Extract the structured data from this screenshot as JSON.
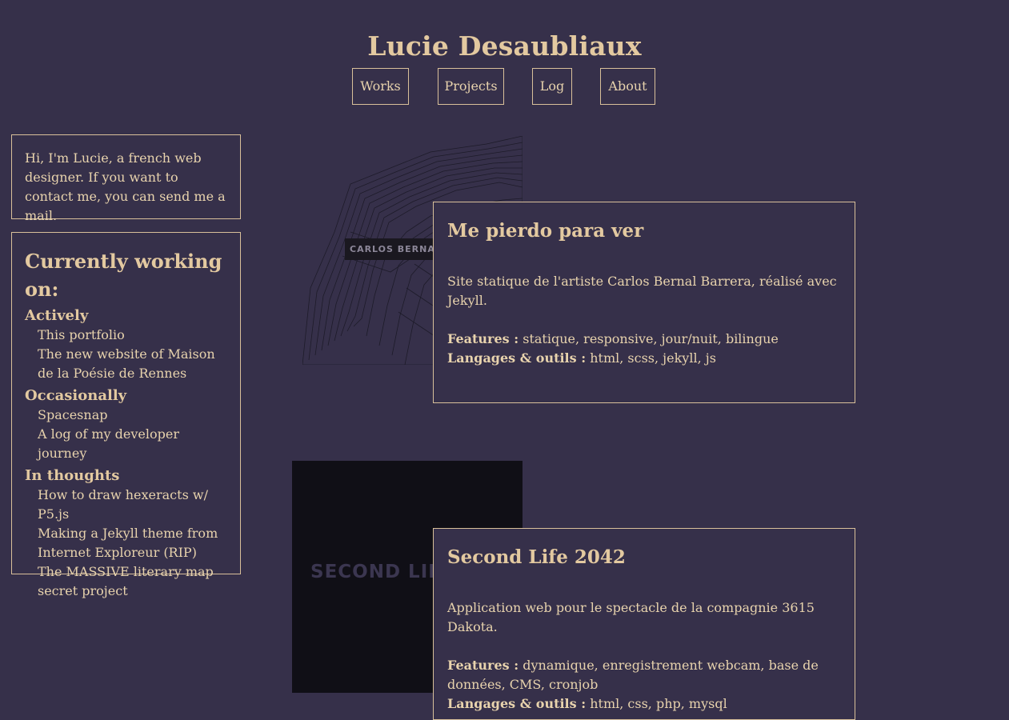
{
  "site": {
    "title": "Lucie Desaubliaux"
  },
  "nav": [
    {
      "label": "Works"
    },
    {
      "label": "Projects"
    },
    {
      "label": "Log"
    },
    {
      "label": "About"
    }
  ],
  "intro": {
    "text": "Hi, I'm Lucie, a french web designer. If you want to contact me, you can send me a mail."
  },
  "working": {
    "heading": "Currently working on:",
    "groups": [
      {
        "title": "Actively",
        "items": [
          "This portfolio",
          "The new website of Maison de la Poésie de Rennes"
        ]
      },
      {
        "title": "Occasionally",
        "items": [
          "Spacesnap",
          "A log of my developer journey"
        ]
      },
      {
        "title": "In thoughts",
        "items": [
          "How to draw hexeracts w/ P5.js",
          "Making a Jekyll theme from Internet Exploreur (RIP)",
          "The MASSIVE literary map secret project"
        ]
      }
    ]
  },
  "projects": [
    {
      "title": "Me pierdo para ver",
      "description": "Site statique de l'artiste Carlos Bernal Barrera, réalisé avec Jekyll.",
      "features_label": "Features :",
      "features": "statique, responsive, jour/nuit, bilingue",
      "tools_label": "Langages & outils :",
      "tools": "html, scss, jekyll, js",
      "thumb_text": "CARLOS BERNAL BA"
    },
    {
      "title": "Second Life 2042",
      "description": "Application web pour le spectacle de la compagnie 3615 Dakota.",
      "features_label": "Features :",
      "features": "dynamique, enregistrement webcam, base de données, CMS, cronjob",
      "tools_label": "Langages & outils :",
      "tools": "html, css, php, mysql",
      "thumb_text": "SECOND LIFE"
    }
  ],
  "colors": {
    "background": "#36304a",
    "accent": "#e3c9a0",
    "border": "#d9c09a"
  }
}
